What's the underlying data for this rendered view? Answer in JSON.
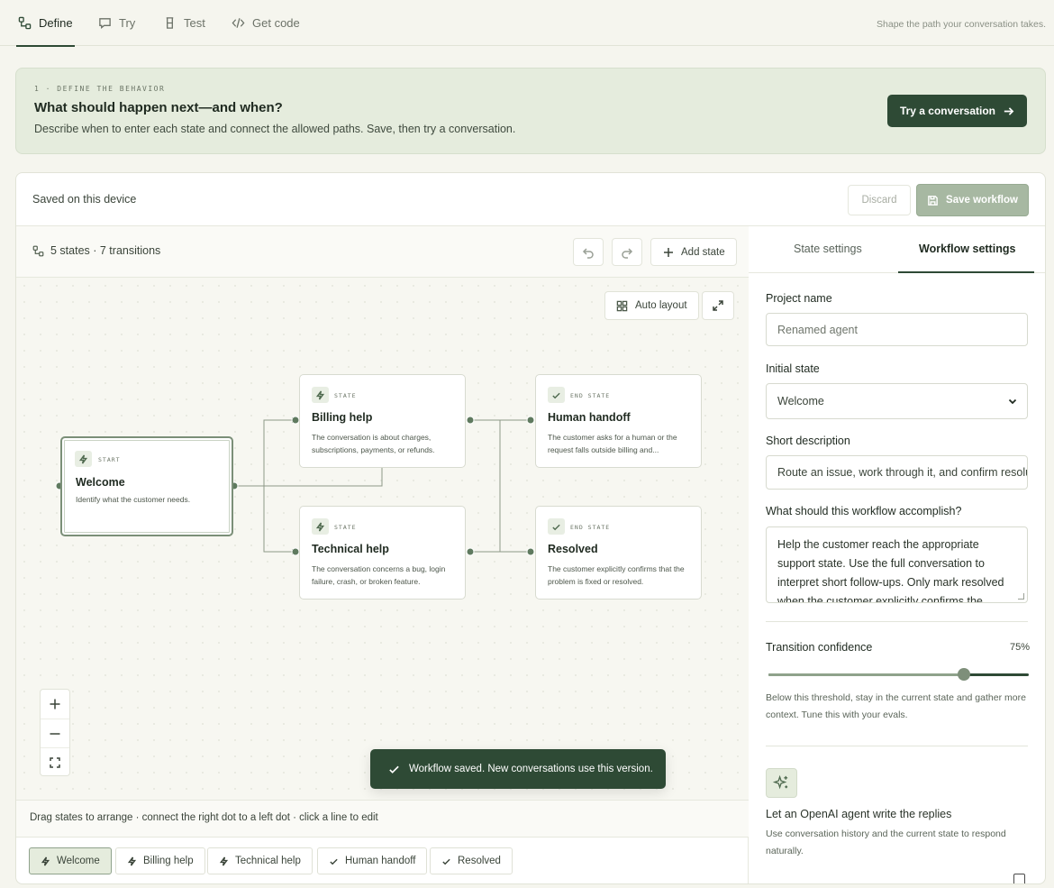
{
  "nav": {
    "tabs": [
      {
        "label": "Define",
        "icon": "workflow-icon",
        "active": true
      },
      {
        "label": "Try",
        "icon": "chat-icon",
        "active": false
      },
      {
        "label": "Test",
        "icon": "beaker-icon",
        "active": false
      },
      {
        "label": "Get code",
        "icon": "code-icon",
        "active": false
      }
    ],
    "hint": "Shape the path your conversation takes."
  },
  "banner": {
    "step": "1 · DEFINE THE BEHAVIOR",
    "title": "What should happen next—and when?",
    "description": "Describe when to enter each state and connect the allowed paths. Save, then try a conversation.",
    "cta": "Try a conversation"
  },
  "workflow_card": {
    "status": "Saved on this device",
    "discard": "Discard",
    "save": "Save workflow"
  },
  "canvas": {
    "counts": "5 states · 7 transitions",
    "add_state": "Add state",
    "auto_layout": "Auto layout",
    "nodes": {
      "welcome": {
        "kind": "START",
        "name": "Welcome",
        "description": "Identify what the customer needs."
      },
      "billing": {
        "kind": "STATE",
        "name": "Billing help",
        "description": "The conversation is about charges, subscriptions, payments, or refunds."
      },
      "technical": {
        "kind": "STATE",
        "name": "Technical help",
        "description": "The conversation concerns a bug, login failure, crash, or broken feature."
      },
      "handoff": {
        "kind": "END STATE",
        "name": "Human handoff",
        "description": "The customer asks for a human or the request falls outside billing and..."
      },
      "resolved": {
        "kind": "END STATE",
        "name": "Resolved",
        "description": "The customer explicitly confirms that the problem is fixed or resolved."
      }
    },
    "toast": "Workflow saved. New conversations use this version.",
    "hint": "Drag states to arrange · connect the right dot to a left dot · click a line to edit",
    "chips": [
      {
        "label": "Welcome",
        "icon": "bolt-icon",
        "active": true
      },
      {
        "label": "Billing help",
        "icon": "bolt-icon",
        "active": false
      },
      {
        "label": "Technical help",
        "icon": "bolt-icon",
        "active": false
      },
      {
        "label": "Human handoff",
        "icon": "check-icon",
        "active": false
      },
      {
        "label": "Resolved",
        "icon": "check-icon",
        "active": false
      }
    ]
  },
  "settings": {
    "tabs": {
      "state": "State settings",
      "workflow": "Workflow settings"
    },
    "project_name_label": "Project name",
    "project_name_placeholder": "Renamed agent",
    "initial_state_label": "Initial state",
    "initial_state_value": "Welcome",
    "short_description_label": "Short description",
    "short_description_value": "Route an issue, work through it, and confirm resolution.",
    "goal_label": "What should this workflow accomplish?",
    "goal_value": "Help the customer reach the appropriate support state. Use the full conversation to interpret short follow-ups. Only mark resolved when the customer explicitly confirms the",
    "confidence_label": "Transition confidence",
    "confidence_display": "75%",
    "confidence_value": 0.75,
    "confidence_help": "Below this threshold, stay in the current state and gather more context. Tune this with your evals.",
    "ai_title": "Let an OpenAI agent write the replies",
    "ai_help": "Use conversation history and the current state to respond naturally."
  },
  "colors": {
    "accent": "#2e4a35",
    "background": "#f5f5ee",
    "banner_bg": "#e5ecdd",
    "save_disabled": "#a7b8a2"
  }
}
